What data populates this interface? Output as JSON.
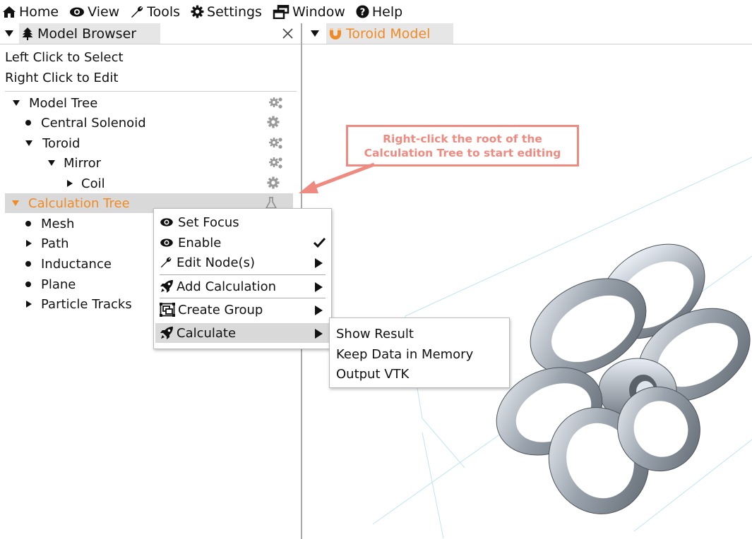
{
  "menubar": {
    "items": [
      {
        "label": "Home",
        "icon": "home-icon"
      },
      {
        "label": "View",
        "icon": "eye-icon"
      },
      {
        "label": "Tools",
        "icon": "wrench-icon"
      },
      {
        "label": "Settings",
        "icon": "gear-icon"
      },
      {
        "label": "Window",
        "icon": "window-icon"
      },
      {
        "label": "Help",
        "icon": "help-icon"
      }
    ]
  },
  "model_browser": {
    "tab_title": "Model Browser",
    "hint_select": "Left Click to Select",
    "hint_edit": "Right Click to Edit",
    "tree": [
      {
        "label": "Model Tree"
      },
      {
        "label": "Central Solenoid"
      },
      {
        "label": "Toroid"
      },
      {
        "label": "Mirror"
      },
      {
        "label": "Coil"
      },
      {
        "label": "Calculation Tree"
      },
      {
        "label": "Mesh"
      },
      {
        "label": "Path"
      },
      {
        "label": "Inductance"
      },
      {
        "label": "Plane"
      },
      {
        "label": "Particle Tracks"
      }
    ]
  },
  "viewport": {
    "tab_title": "Toroid Model",
    "accent": "#f08a24"
  },
  "context_menu": {
    "items": [
      {
        "label": "Set Focus"
      },
      {
        "label": "Enable"
      },
      {
        "label": "Edit Node(s)"
      },
      {
        "label": "Add Calculation"
      },
      {
        "label": "Create Group"
      },
      {
        "label": "Calculate"
      }
    ]
  },
  "submenu": {
    "items": [
      {
        "label": "Show Result"
      },
      {
        "label": "Keep Data in Memory"
      },
      {
        "label": "Output VTK"
      }
    ]
  },
  "callout": {
    "line1": "Right-click the root of the",
    "line2": "Calculation Tree to start editing",
    "color": "#ef8a80"
  }
}
